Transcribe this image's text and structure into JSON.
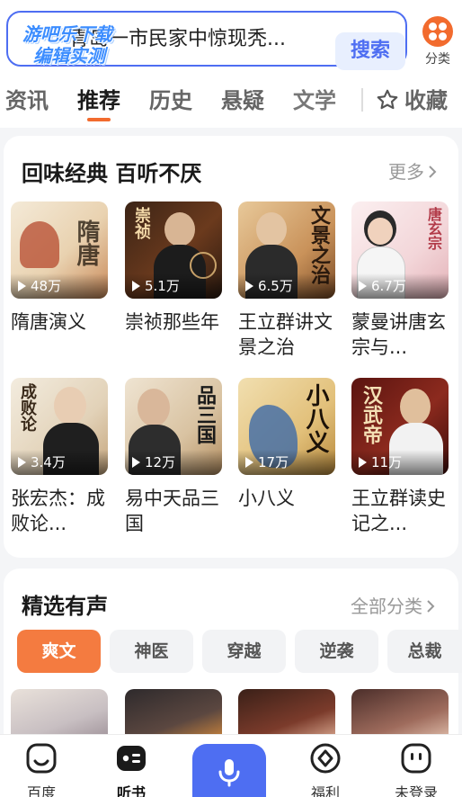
{
  "search": {
    "watermark_line1": "游吧乐下载",
    "watermark_line2": "编辑实测",
    "query": "青岛一市民家中惊现秃...",
    "button_label": "搜索"
  },
  "category_button": {
    "label": "分类"
  },
  "tabs": [
    {
      "label": "资讯"
    },
    {
      "label": "推荐"
    },
    {
      "label": "历史"
    },
    {
      "label": "悬疑"
    },
    {
      "label": "文学"
    }
  ],
  "favorites_tab": {
    "label": "收藏"
  },
  "classics": {
    "title": "回味经典 百听不厌",
    "more_label": "更多",
    "items": [
      {
        "title": "隋唐演义",
        "plays": "48万",
        "cover_text": "隋唐"
      },
      {
        "title": "崇祯那些年",
        "plays": "5.1万",
        "cover_text": "崇祯"
      },
      {
        "title": "王立群讲文景之治",
        "plays": "6.5万",
        "cover_text": "文景之治"
      },
      {
        "title": "蒙曼讲唐玄宗与...",
        "plays": "6.7万",
        "cover_text": "唐玄宗"
      },
      {
        "title": "张宏杰：成败论...",
        "plays": "3.4万",
        "cover_text": "成败论"
      },
      {
        "title": "易中天品三国",
        "plays": "12万",
        "cover_text": "品三国"
      },
      {
        "title": "小八义",
        "plays": "17万",
        "cover_text": "小八义"
      },
      {
        "title": "王立群读史记之...",
        "plays": "11万",
        "cover_text": "汉武帝"
      }
    ]
  },
  "selected_audio": {
    "title": "精选有声",
    "more_label": "全部分类",
    "chips": [
      {
        "label": "爽文"
      },
      {
        "label": "神医"
      },
      {
        "label": "穿越"
      },
      {
        "label": "逆袭"
      },
      {
        "label": "总裁"
      }
    ]
  },
  "bottom_nav": [
    {
      "label": "百度"
    },
    {
      "label": "听书"
    },
    {
      "label": "福利"
    },
    {
      "label": "未登录"
    }
  ],
  "colors": {
    "accent": "#f26b2e",
    "brand_blue": "#4e6ef2",
    "chip_active": "#f47b40"
  }
}
